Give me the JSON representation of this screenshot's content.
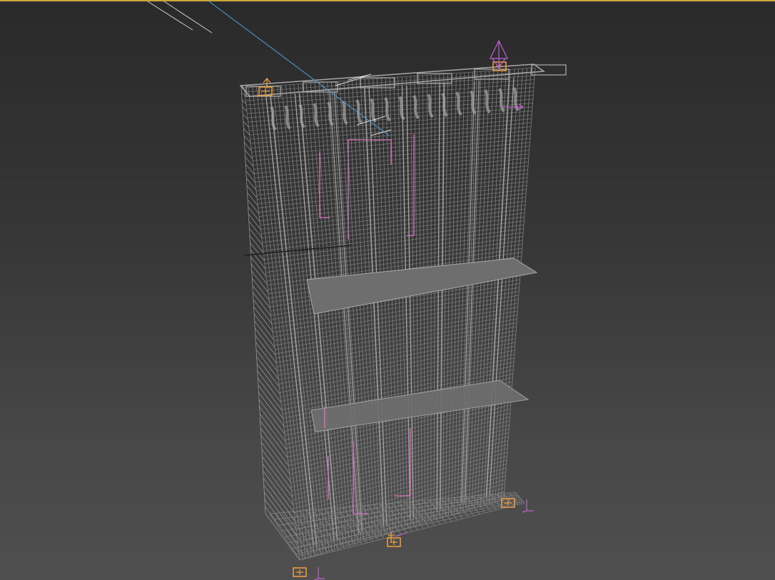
{
  "viewport": {
    "mode": "perspective",
    "active": true,
    "render_style": "wireframe",
    "colors": {
      "background_top": "#2a2a2a",
      "background_bottom": "#4f4f4f",
      "active_border": "#c8a83a",
      "wire": "#8c8c8c",
      "wire_light": "#a8a8a8",
      "shaded_slab": "#6e6e6e",
      "light_gizmo": "#f0a040",
      "helper": "#c060d0",
      "pink_wire": "#e070c0",
      "camera_line": "#4aa0e0",
      "selected": "#ffffff"
    }
  },
  "scene": {
    "object": "building-facade",
    "lights": [
      {
        "name": "light-top-left",
        "icon": "light-icon"
      },
      {
        "name": "light-top-right",
        "icon": "light-icon"
      },
      {
        "name": "light-bottom-left",
        "icon": "light-icon"
      },
      {
        "name": "light-bottom-center",
        "icon": "light-icon"
      },
      {
        "name": "light-bottom-right",
        "icon": "light-icon"
      }
    ]
  }
}
